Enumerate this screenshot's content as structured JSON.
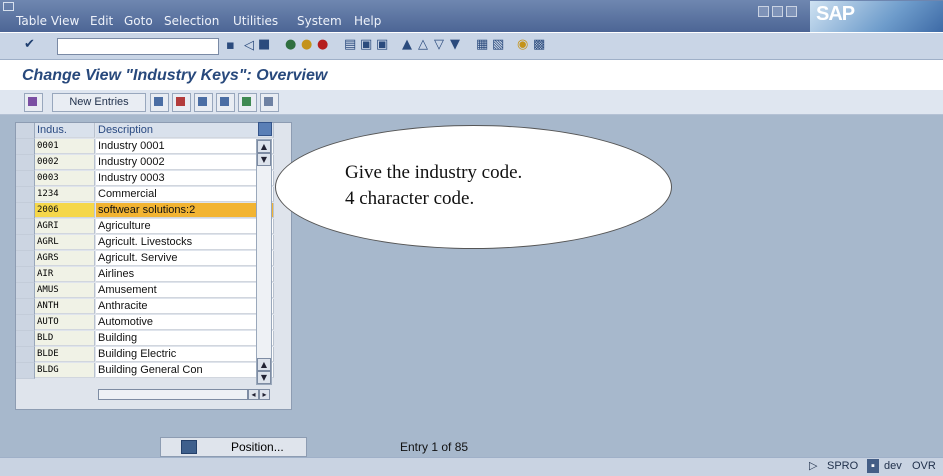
{
  "menu": {
    "items": [
      {
        "key": "table_view",
        "label": "Table View"
      },
      {
        "key": "edit",
        "label": "Edit"
      },
      {
        "key": "goto",
        "label": "Goto"
      },
      {
        "key": "selection",
        "label": "Selection"
      },
      {
        "key": "utilities",
        "label": "Utilities"
      },
      {
        "key": "system",
        "label": "System"
      },
      {
        "key": "help",
        "label": "Help"
      }
    ]
  },
  "brand": {
    "logo": "SAP"
  },
  "screen": {
    "title": "Change View \"Industry Keys\": Overview"
  },
  "app_toolbar": {
    "new_entries": "New Entries"
  },
  "table": {
    "headers": {
      "code": "Indus.",
      "description": "Description"
    },
    "rows": [
      {
        "code": "0001",
        "description": "Industry 0001"
      },
      {
        "code": "0002",
        "description": "Industry 0002"
      },
      {
        "code": "0003",
        "description": "Industry 0003"
      },
      {
        "code": "1234",
        "description": "Commercial"
      },
      {
        "code": "2006",
        "description": "softwear solutions:2"
      },
      {
        "code": "AGRI",
        "description": "Agriculture"
      },
      {
        "code": "AGRL",
        "description": "Agricult. Livestocks"
      },
      {
        "code": "AGRS",
        "description": "Agricult. Servive"
      },
      {
        "code": "AIR",
        "description": "Airlines"
      },
      {
        "code": "AMUS",
        "description": "Amusement"
      },
      {
        "code": "ANTH",
        "description": "Anthracite"
      },
      {
        "code": "AUTO",
        "description": "Automotive"
      },
      {
        "code": "BLD",
        "description": "Building"
      },
      {
        "code": "BLDE",
        "description": "Building Electric"
      },
      {
        "code": "BLDG",
        "description": "Building General Con"
      }
    ]
  },
  "callout": {
    "line1": "Give the industry code.",
    "line2": "4 character code."
  },
  "footer": {
    "position_label": "Position...",
    "entry_text": "Entry 1 of 85"
  },
  "status": {
    "transaction": "SPRO",
    "system": "dev",
    "mode": "OVR"
  },
  "colors": {
    "highlight_row": "#f2b432",
    "title": "#28497c"
  }
}
